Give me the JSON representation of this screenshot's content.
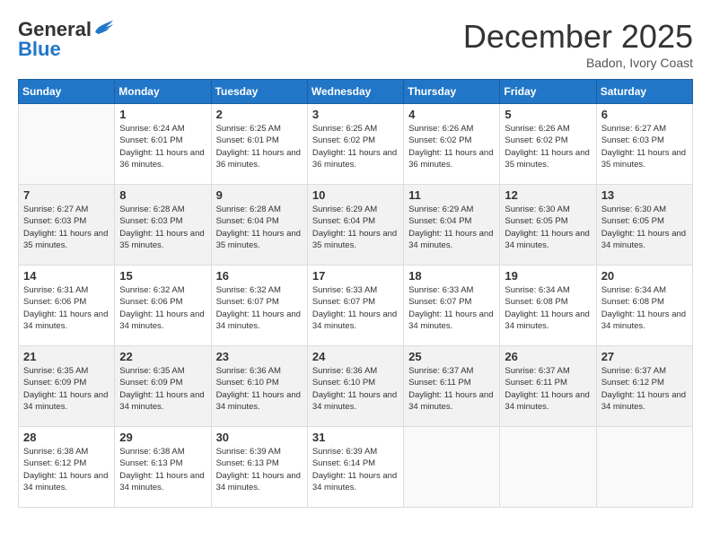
{
  "header": {
    "logo_general": "General",
    "logo_blue": "Blue",
    "month": "December 2025",
    "location": "Badon, Ivory Coast"
  },
  "weekdays": [
    "Sunday",
    "Monday",
    "Tuesday",
    "Wednesday",
    "Thursday",
    "Friday",
    "Saturday"
  ],
  "weeks": [
    [
      {
        "day": "",
        "sunrise": "",
        "sunset": "",
        "daylight": ""
      },
      {
        "day": "1",
        "sunrise": "Sunrise: 6:24 AM",
        "sunset": "Sunset: 6:01 PM",
        "daylight": "Daylight: 11 hours and 36 minutes."
      },
      {
        "day": "2",
        "sunrise": "Sunrise: 6:25 AM",
        "sunset": "Sunset: 6:01 PM",
        "daylight": "Daylight: 11 hours and 36 minutes."
      },
      {
        "day": "3",
        "sunrise": "Sunrise: 6:25 AM",
        "sunset": "Sunset: 6:02 PM",
        "daylight": "Daylight: 11 hours and 36 minutes."
      },
      {
        "day": "4",
        "sunrise": "Sunrise: 6:26 AM",
        "sunset": "Sunset: 6:02 PM",
        "daylight": "Daylight: 11 hours and 36 minutes."
      },
      {
        "day": "5",
        "sunrise": "Sunrise: 6:26 AM",
        "sunset": "Sunset: 6:02 PM",
        "daylight": "Daylight: 11 hours and 35 minutes."
      },
      {
        "day": "6",
        "sunrise": "Sunrise: 6:27 AM",
        "sunset": "Sunset: 6:03 PM",
        "daylight": "Daylight: 11 hours and 35 minutes."
      }
    ],
    [
      {
        "day": "7",
        "sunrise": "Sunrise: 6:27 AM",
        "sunset": "Sunset: 6:03 PM",
        "daylight": "Daylight: 11 hours and 35 minutes."
      },
      {
        "day": "8",
        "sunrise": "Sunrise: 6:28 AM",
        "sunset": "Sunset: 6:03 PM",
        "daylight": "Daylight: 11 hours and 35 minutes."
      },
      {
        "day": "9",
        "sunrise": "Sunrise: 6:28 AM",
        "sunset": "Sunset: 6:04 PM",
        "daylight": "Daylight: 11 hours and 35 minutes."
      },
      {
        "day": "10",
        "sunrise": "Sunrise: 6:29 AM",
        "sunset": "Sunset: 6:04 PM",
        "daylight": "Daylight: 11 hours and 35 minutes."
      },
      {
        "day": "11",
        "sunrise": "Sunrise: 6:29 AM",
        "sunset": "Sunset: 6:04 PM",
        "daylight": "Daylight: 11 hours and 34 minutes."
      },
      {
        "day": "12",
        "sunrise": "Sunrise: 6:30 AM",
        "sunset": "Sunset: 6:05 PM",
        "daylight": "Daylight: 11 hours and 34 minutes."
      },
      {
        "day": "13",
        "sunrise": "Sunrise: 6:30 AM",
        "sunset": "Sunset: 6:05 PM",
        "daylight": "Daylight: 11 hours and 34 minutes."
      }
    ],
    [
      {
        "day": "14",
        "sunrise": "Sunrise: 6:31 AM",
        "sunset": "Sunset: 6:06 PM",
        "daylight": "Daylight: 11 hours and 34 minutes."
      },
      {
        "day": "15",
        "sunrise": "Sunrise: 6:32 AM",
        "sunset": "Sunset: 6:06 PM",
        "daylight": "Daylight: 11 hours and 34 minutes."
      },
      {
        "day": "16",
        "sunrise": "Sunrise: 6:32 AM",
        "sunset": "Sunset: 6:07 PM",
        "daylight": "Daylight: 11 hours and 34 minutes."
      },
      {
        "day": "17",
        "sunrise": "Sunrise: 6:33 AM",
        "sunset": "Sunset: 6:07 PM",
        "daylight": "Daylight: 11 hours and 34 minutes."
      },
      {
        "day": "18",
        "sunrise": "Sunrise: 6:33 AM",
        "sunset": "Sunset: 6:07 PM",
        "daylight": "Daylight: 11 hours and 34 minutes."
      },
      {
        "day": "19",
        "sunrise": "Sunrise: 6:34 AM",
        "sunset": "Sunset: 6:08 PM",
        "daylight": "Daylight: 11 hours and 34 minutes."
      },
      {
        "day": "20",
        "sunrise": "Sunrise: 6:34 AM",
        "sunset": "Sunset: 6:08 PM",
        "daylight": "Daylight: 11 hours and 34 minutes."
      }
    ],
    [
      {
        "day": "21",
        "sunrise": "Sunrise: 6:35 AM",
        "sunset": "Sunset: 6:09 PM",
        "daylight": "Daylight: 11 hours and 34 minutes."
      },
      {
        "day": "22",
        "sunrise": "Sunrise: 6:35 AM",
        "sunset": "Sunset: 6:09 PM",
        "daylight": "Daylight: 11 hours and 34 minutes."
      },
      {
        "day": "23",
        "sunrise": "Sunrise: 6:36 AM",
        "sunset": "Sunset: 6:10 PM",
        "daylight": "Daylight: 11 hours and 34 minutes."
      },
      {
        "day": "24",
        "sunrise": "Sunrise: 6:36 AM",
        "sunset": "Sunset: 6:10 PM",
        "daylight": "Daylight: 11 hours and 34 minutes."
      },
      {
        "day": "25",
        "sunrise": "Sunrise: 6:37 AM",
        "sunset": "Sunset: 6:11 PM",
        "daylight": "Daylight: 11 hours and 34 minutes."
      },
      {
        "day": "26",
        "sunrise": "Sunrise: 6:37 AM",
        "sunset": "Sunset: 6:11 PM",
        "daylight": "Daylight: 11 hours and 34 minutes."
      },
      {
        "day": "27",
        "sunrise": "Sunrise: 6:37 AM",
        "sunset": "Sunset: 6:12 PM",
        "daylight": "Daylight: 11 hours and 34 minutes."
      }
    ],
    [
      {
        "day": "28",
        "sunrise": "Sunrise: 6:38 AM",
        "sunset": "Sunset: 6:12 PM",
        "daylight": "Daylight: 11 hours and 34 minutes."
      },
      {
        "day": "29",
        "sunrise": "Sunrise: 6:38 AM",
        "sunset": "Sunset: 6:13 PM",
        "daylight": "Daylight: 11 hours and 34 minutes."
      },
      {
        "day": "30",
        "sunrise": "Sunrise: 6:39 AM",
        "sunset": "Sunset: 6:13 PM",
        "daylight": "Daylight: 11 hours and 34 minutes."
      },
      {
        "day": "31",
        "sunrise": "Sunrise: 6:39 AM",
        "sunset": "Sunset: 6:14 PM",
        "daylight": "Daylight: 11 hours and 34 minutes."
      },
      {
        "day": "",
        "sunrise": "",
        "sunset": "",
        "daylight": ""
      },
      {
        "day": "",
        "sunrise": "",
        "sunset": "",
        "daylight": ""
      },
      {
        "day": "",
        "sunrise": "",
        "sunset": "",
        "daylight": ""
      }
    ]
  ]
}
